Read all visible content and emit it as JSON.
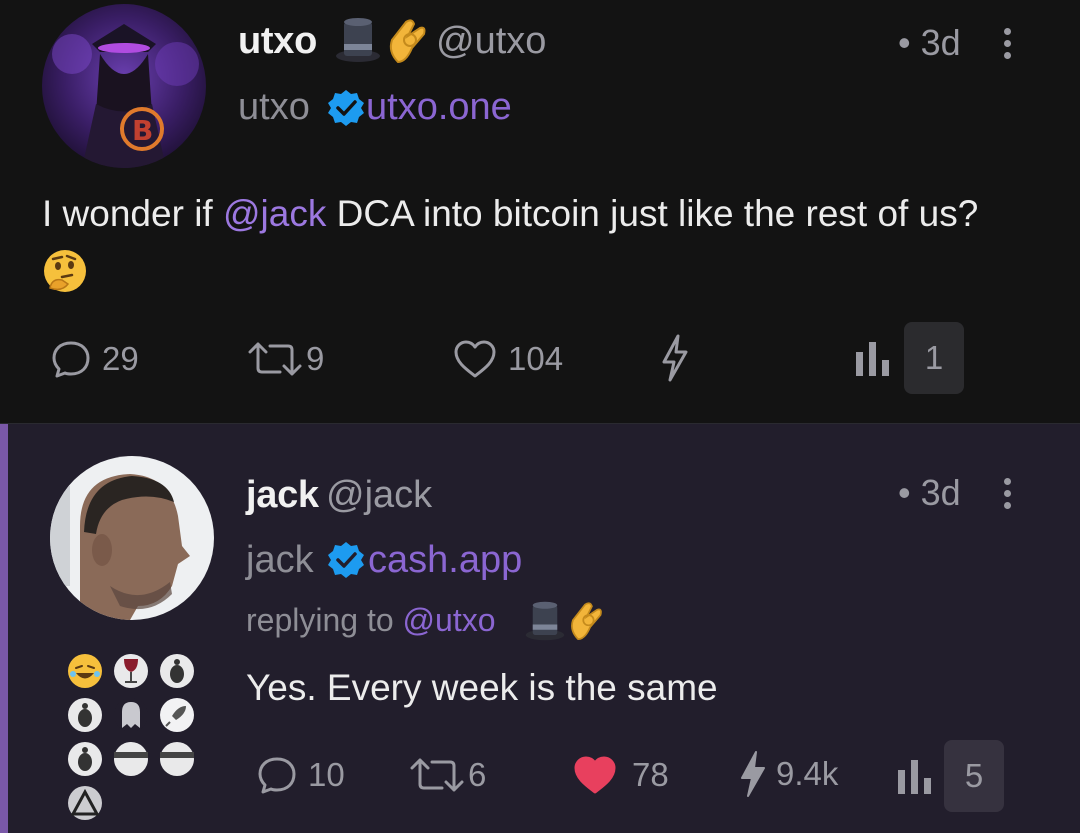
{
  "post1": {
    "name": "utxo",
    "name_emojis": [
      "top-hat",
      "pinching-hand"
    ],
    "handle": "@utxo",
    "nip05_name": "utxo",
    "nip05_domain": "utxo.one",
    "time": "• 3d",
    "content_before": "I wonder if ",
    "content_mention": "@jack",
    "content_after": " DCA into bitcoin just like the rest of us? ",
    "content_emoji": "thinking-face",
    "replies": "29",
    "reposts": "9",
    "likes": "104",
    "zaps": "",
    "views": "1"
  },
  "post2": {
    "name": "jack",
    "handle": "@jack",
    "nip05_name": "jack",
    "nip05_domain": "cash.app",
    "time": "• 3d",
    "replying_prefix": "replying to ",
    "replying_handle": "@utxo",
    "content": "Yes. Every week is the same",
    "replies": "10",
    "reposts": "6",
    "likes": "78",
    "zaps": "9.4k",
    "views": "5"
  },
  "colors": {
    "accent": "#8b66d2",
    "like_active": "#e8405e",
    "verified": "#1d9bf0"
  }
}
